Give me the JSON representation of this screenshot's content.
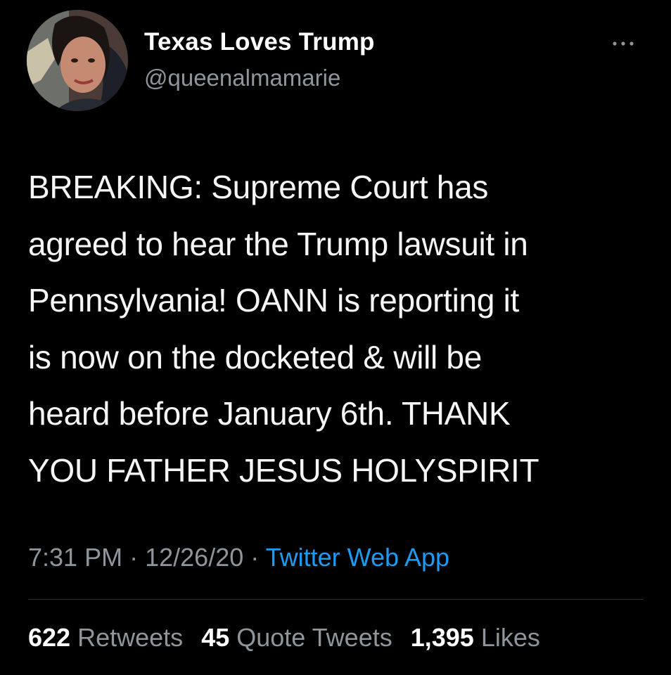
{
  "tweet": {
    "author": {
      "display_name": "Texas Loves Trump",
      "handle": "@queenalmamarie",
      "avatar_icon": "profile-photo"
    },
    "more_icon": "ellipsis-icon",
    "text": "BREAKING: Supreme Court has\nagreed to hear the Trump lawsuit in\nPennsylvania!  OANN is reporting it\nis now on the docketed & will be\nheard before January 6th. THANK\nYOU FATHER JESUS HOLYSPIRIT",
    "time": "7:31 PM",
    "separator": "·",
    "date": "12/26/20",
    "source": "Twitter Web App",
    "stats": {
      "retweets_count": "622",
      "retweets_label": "Retweets",
      "quotes_count": "45",
      "quotes_label": "Quote Tweets",
      "likes_count": "1,395",
      "likes_label": "Likes"
    }
  },
  "colors": {
    "background": "#000000",
    "text_primary": "#ffffff",
    "text_secondary": "#8e959c",
    "link": "#1d9bf0",
    "divider": "#2f3336"
  }
}
